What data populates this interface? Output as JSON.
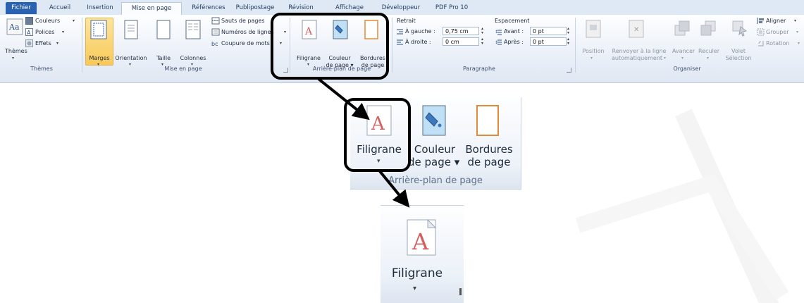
{
  "ribbon": {
    "tabs": [
      {
        "label": "Fichier"
      },
      {
        "label": "Accueil"
      },
      {
        "label": "Insertion"
      },
      {
        "label": "Mise en page"
      },
      {
        "label": "Références"
      },
      {
        "label": "Publipostage"
      },
      {
        "label": "Révision"
      },
      {
        "label": "Affichage"
      },
      {
        "label": "Développeur"
      },
      {
        "label": "PDF Pro 10"
      }
    ],
    "groups": {
      "themes": {
        "label": "Thèmes",
        "themes_button": "Thèmes",
        "couleurs": "Couleurs",
        "polices": "Polices",
        "effets": "Effets"
      },
      "mise_en_page": {
        "label": "Mise en page",
        "marges": "Marges",
        "orientation": "Orientation",
        "taille": "Taille",
        "colonnes": "Colonnes",
        "sauts": "Sauts de pages",
        "numeros": "Numéros de lignes",
        "coupure": "Coupure de mots"
      },
      "arriere_plan": {
        "label": "Arrière-plan de page",
        "filigrane": "Filigrane",
        "couleur_line1": "Couleur",
        "couleur_line2": "de page",
        "bordures_line1": "Bordures",
        "bordures_line2": "de page"
      },
      "paragraphe": {
        "label": "Paragraphe",
        "retrait": "Retrait",
        "espacement": "Espacement",
        "gauche_label": "À gauche :",
        "gauche_value": "0,75 cm",
        "droite_label": "À droite :",
        "droite_value": "0 cm",
        "avant_label": "Avant :",
        "avant_value": "0 pt",
        "apres_label": "Après :",
        "apres_value": "0 pt"
      },
      "organiser": {
        "label": "Organiser",
        "position": "Position",
        "renvoyer_line1": "Renvoyer à la ligne",
        "renvoyer_line2": "automatiquement",
        "avancer": "Avancer",
        "reculer": "Reculer",
        "volet_line1": "Volet",
        "volet_line2": "Sélection",
        "aligner": "Aligner",
        "grouper": "Grouper",
        "rotation": "Rotation"
      }
    }
  },
  "zoom1": {
    "filigrane": "Filigrane",
    "couleur_line1": "Couleur",
    "couleur_line2": "de page",
    "bordures_line1": "Bordures",
    "bordures_line2": "de page",
    "group_label": "Arrière-plan de page"
  },
  "zoom2": {
    "filigrane": "Filigrane",
    "dropdown_arrow": "▾"
  },
  "colors": {
    "file_tab": "#2a62b1",
    "marges_highlight": "#f8c95a",
    "callout": "#000000"
  }
}
